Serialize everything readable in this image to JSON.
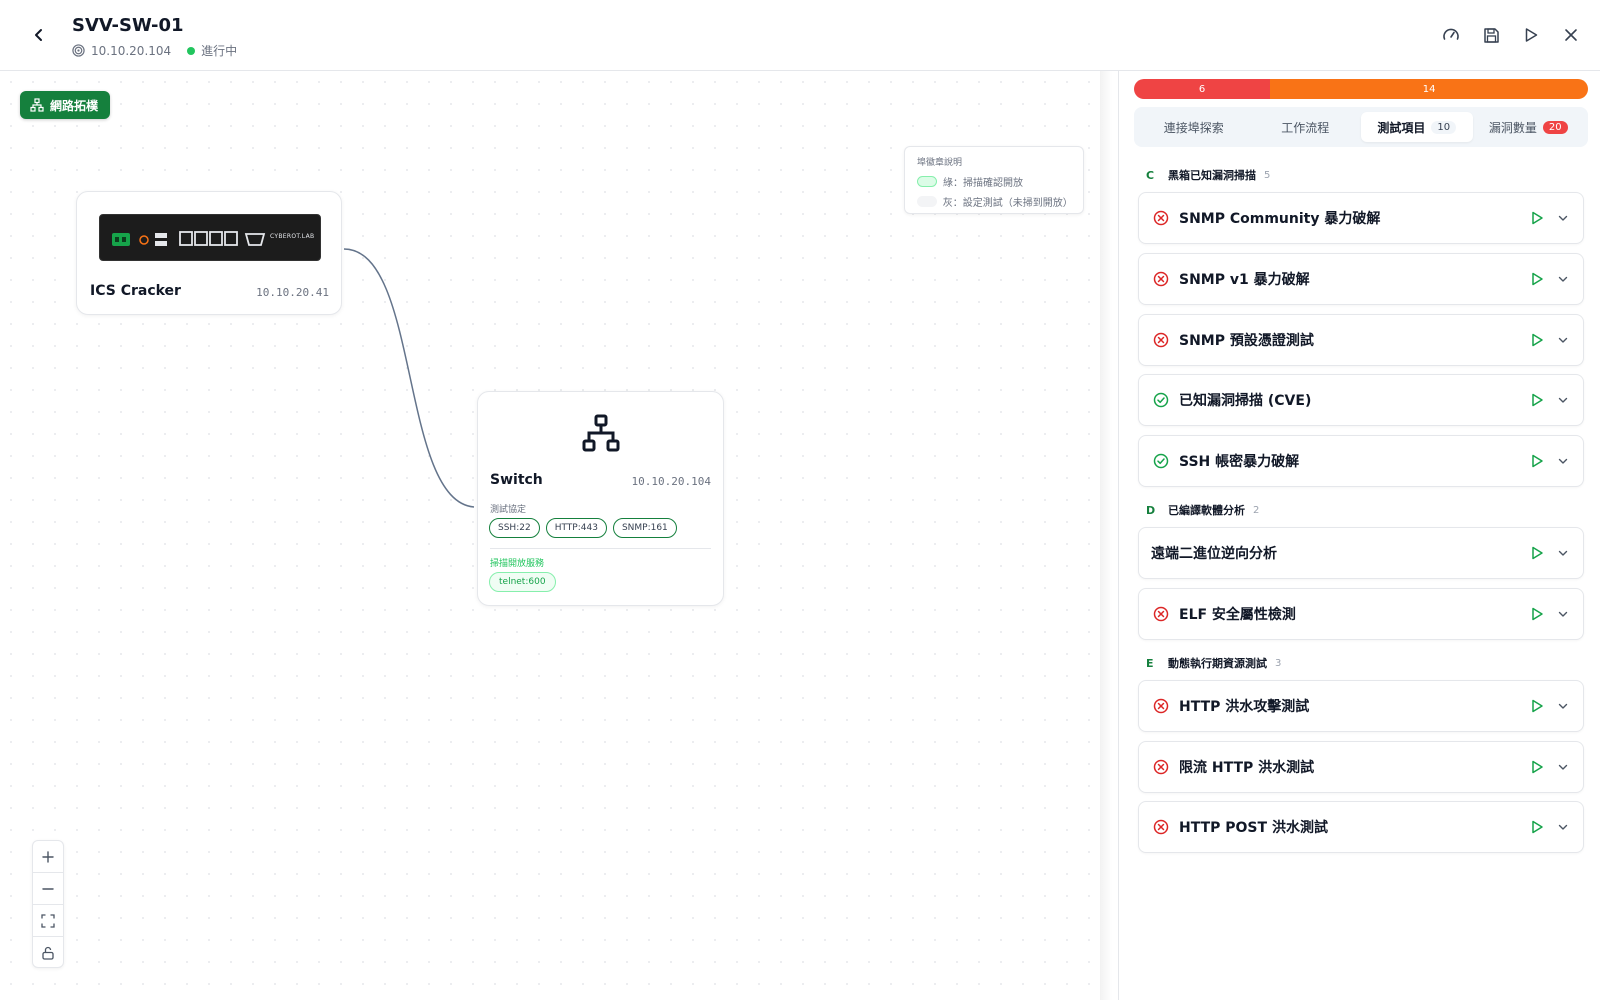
{
  "header": {
    "title": "SVV-SW-01",
    "ip": "10.10.20.104",
    "status": "進行中"
  },
  "canvas": {
    "topology_button": "網路拓樸",
    "legend": {
      "title": "埠徽章說明",
      "green": "綠：掃描確認開放",
      "gray": "灰：設定測試（未掃到開放）"
    },
    "nodes": {
      "ics": {
        "name": "ICS Cracker",
        "ip": "10.10.20.41",
        "brand": "CYBEROT.LAB"
      },
      "switch": {
        "name": "Switch",
        "ip": "10.10.20.104",
        "protocol_label": "測試協定",
        "protocols": [
          "SSH:22",
          "HTTP:443",
          "SNMP:161"
        ],
        "open_label": "掃描開放服務",
        "open_service": "telnet:600"
      }
    }
  },
  "panel": {
    "progress": {
      "red": 6,
      "orange": 14
    },
    "tabs": [
      {
        "label": "連接埠探索"
      },
      {
        "label": "工作流程"
      },
      {
        "label": "測試項目",
        "badge": "10"
      },
      {
        "label": "漏洞數量",
        "badge": "20"
      }
    ],
    "groups": [
      {
        "letter": "C",
        "title": "黑箱已知漏洞掃描",
        "count": "5"
      },
      {
        "letter": "D",
        "title": "已編譯軟體分析",
        "count": "2"
      },
      {
        "letter": "E",
        "title": "動態執行期資源測試",
        "count": "3"
      }
    ],
    "items": [
      {
        "label": "SNMP Community 暴力破解",
        "status": "fail"
      },
      {
        "label": "SNMP v1 暴力破解",
        "status": "fail"
      },
      {
        "label": "SNMP 預設憑證測試",
        "status": "fail"
      },
      {
        "label": "已知漏洞掃描 (CVE)",
        "status": "pass"
      },
      {
        "label": "SSH 帳密暴力破解",
        "status": "pass"
      },
      {
        "label": "遠端二進位逆向分析",
        "status": "none"
      },
      {
        "label": "ELF 安全屬性檢測",
        "status": "fail"
      },
      {
        "label": "HTTP 洪水攻擊測試",
        "status": "fail"
      },
      {
        "label": "限流 HTTP 洪水測試",
        "status": "fail"
      },
      {
        "label": "HTTP POST 洪水測試",
        "status": "fail"
      }
    ]
  },
  "colors": {
    "accent": "#15803d",
    "fail": "#dc2626",
    "pass": "#16a34a",
    "progress_red": "#ef4444",
    "progress_orange": "#f97316"
  },
  "icons": [
    "chevron-left-icon",
    "target-icon",
    "gauge-icon",
    "save-icon",
    "play-icon",
    "close-icon",
    "network-icon",
    "zoom-in-icon",
    "zoom-out-icon",
    "fit-view-icon",
    "unlock-icon",
    "x-circle-icon",
    "check-circle-icon",
    "chevron-down-icon"
  ]
}
